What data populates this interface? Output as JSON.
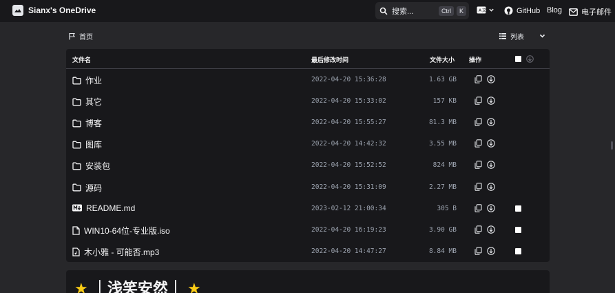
{
  "app": {
    "title": "Sianx's OneDrive",
    "logo_icon": "cloud-logo-icon"
  },
  "header": {
    "search": {
      "label": "搜索...",
      "shortcut_mod": "Ctrl",
      "shortcut_key": "K",
      "icon": "search-icon"
    },
    "language_icon": "translate-icon",
    "links": [
      {
        "label": "GitHub",
        "icon": "github-icon"
      },
      {
        "label": "Blog"
      },
      {
        "label": "电子邮件",
        "icon": "mail-icon"
      }
    ]
  },
  "breadcrumb": {
    "home_label": "首页",
    "icon": "flag-icon"
  },
  "layout_switch": {
    "label": "列表",
    "icon": "list-icon"
  },
  "table": {
    "columns": {
      "name": "文件名",
      "modified": "最后修改时间",
      "size": "文件大小",
      "actions": "操作"
    },
    "rows": [
      {
        "name": "作业",
        "type": "folder",
        "modified": "2022-04-20 15:36:28",
        "size": "1.63 GB"
      },
      {
        "name": "其它",
        "type": "folder",
        "modified": "2022-04-20 15:33:02",
        "size": "157 KB"
      },
      {
        "name": "博客",
        "type": "folder",
        "modified": "2022-04-20 15:55:27",
        "size": "81.3 MB"
      },
      {
        "name": "图库",
        "type": "folder",
        "modified": "2022-04-20 14:42:32",
        "size": "3.55 MB"
      },
      {
        "name": "安装包",
        "type": "folder",
        "modified": "2022-04-20 15:52:52",
        "size": "824 MB"
      },
      {
        "name": "源码",
        "type": "folder",
        "modified": "2022-04-20 15:31:09",
        "size": "2.27 MB"
      },
      {
        "name": "README.md",
        "type": "markdown",
        "modified": "2023-02-12 21:00:34",
        "size": "305 B"
      },
      {
        "name": "WIN10-64位-专业版.iso",
        "type": "file",
        "modified": "2022-04-20 16:19:23",
        "size": "3.90 GB"
      },
      {
        "name": "木小雅 - 可能否.mp3",
        "type": "audio",
        "modified": "2022-04-20 14:47:27",
        "size": "8.84 MB"
      }
    ]
  },
  "readme": {
    "title": "★ ｜浅笑安然｜ ★"
  }
}
